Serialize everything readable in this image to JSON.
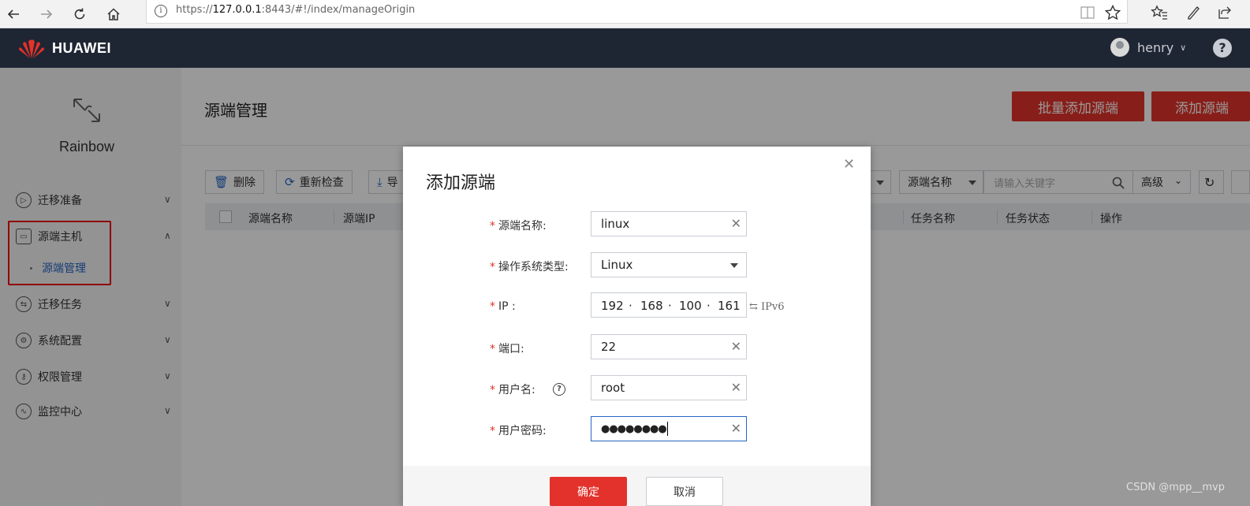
{
  "browser": {
    "url_prefix": "https://",
    "url_host": "127.0.0.1",
    "url_rest": ":8443/#!/index/manageOrigin"
  },
  "header": {
    "logo_text": "HUAWEI",
    "username": "henry",
    "help": "?"
  },
  "sidebar": {
    "brand_name": "Rainbow",
    "items": [
      {
        "label": "迁移准备",
        "expanded": false
      },
      {
        "label": "源端主机",
        "expanded": true
      },
      {
        "label": "迁移任务",
        "expanded": false
      },
      {
        "label": "系统配置",
        "expanded": false
      },
      {
        "label": "权限管理",
        "expanded": false
      },
      {
        "label": "监控中心",
        "expanded": false
      }
    ],
    "subitem": "源端管理"
  },
  "main": {
    "title": "源端管理",
    "batch_add": "批量添加源端",
    "add": "添加源端",
    "toolbar": {
      "delete": "删除",
      "recheck": "重新检查",
      "export": "导"
    },
    "filter_select": "源端名称",
    "search_placeholder": "请输入关键字",
    "advanced": "高级",
    "columns": [
      "源端名称",
      "源端IP",
      "任务名称",
      "任务状态",
      "操作"
    ]
  },
  "dialog": {
    "title": "添加源端",
    "fields": {
      "name_label": "源端名称:",
      "name_value": "linux",
      "os_label": "操作系统类型:",
      "os_value": "Linux",
      "ip_label": "IP :",
      "ip_parts": [
        "192",
        "168",
        "100",
        "161"
      ],
      "ipv6_link": "IPv6",
      "port_label": "端口:",
      "port_value": "22",
      "user_label": "用户名:",
      "user_value": "root",
      "password_label": "用户密码:",
      "password_value": "●●●●●●●●"
    },
    "ok": "确定",
    "cancel": "取消"
  },
  "watermark": "CSDN @mpp__mvp",
  "colors": {
    "brand_red": "#e3322b",
    "header_bg": "#1f2633",
    "link_blue": "#2566c2"
  }
}
